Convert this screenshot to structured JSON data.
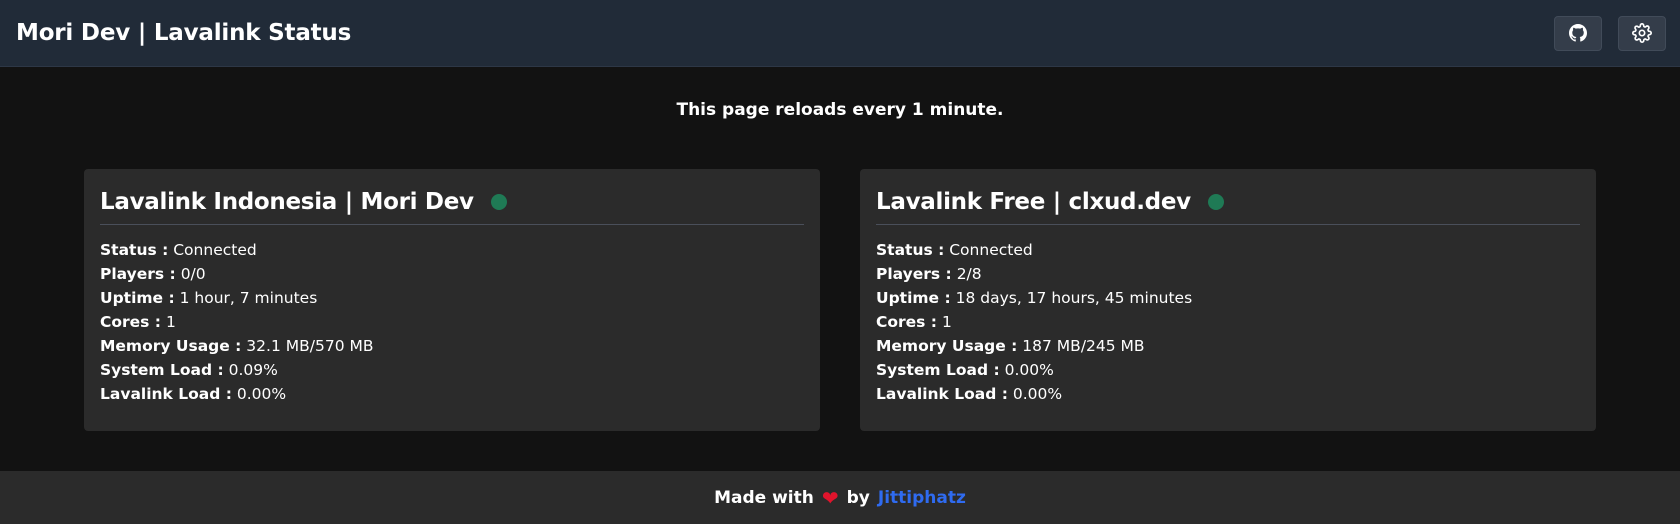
{
  "header": {
    "title": "Mori Dev | Lavalink Status",
    "buttons": [
      {
        "icon": "github-icon"
      },
      {
        "icon": "gear-icon"
      }
    ]
  },
  "notice": "This page reloads every 1 minute.",
  "nodes": [
    {
      "name": "Lavalink Indonesia | Mori Dev",
      "online": true,
      "status_color": "#1f7a55",
      "stats": [
        {
          "label": "Status :",
          "value": "Connected"
        },
        {
          "label": "Players :",
          "value": "0/0"
        },
        {
          "label": "Uptime :",
          "value": "1 hour, 7 minutes"
        },
        {
          "label": "Cores :",
          "value": "1"
        },
        {
          "label": "Memory Usage :",
          "value": "32.1 MB/570 MB"
        },
        {
          "label": "System Load :",
          "value": "0.09%"
        },
        {
          "label": "Lavalink Load :",
          "value": "0.00%"
        }
      ]
    },
    {
      "name": "Lavalink Free | clxud.dev",
      "online": true,
      "status_color": "#1f7a55",
      "stats": [
        {
          "label": "Status :",
          "value": "Connected"
        },
        {
          "label": "Players :",
          "value": "2/8"
        },
        {
          "label": "Uptime :",
          "value": "18 days, 17 hours, 45 minutes"
        },
        {
          "label": "Cores :",
          "value": "1"
        },
        {
          "label": "Memory Usage :",
          "value": "187 MB/245 MB"
        },
        {
          "label": "System Load :",
          "value": "0.00%"
        },
        {
          "label": "Lavalink Load :",
          "value": "0.00%"
        }
      ]
    }
  ],
  "footer": {
    "made_with": "Made with",
    "heart": "❤",
    "by": "by",
    "author": "Jittiphatz",
    "author_color": "#2f6bf0"
  }
}
